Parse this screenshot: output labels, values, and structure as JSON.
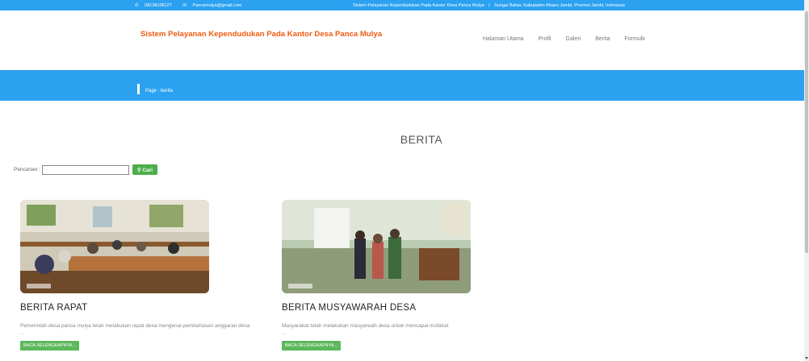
{
  "topbar": {
    "phone": "08138108127",
    "email": "Pancamulya@gmail.com",
    "site_name": "Sistem Pelayanan Kependudukan Pada Kantor Desa Panca Mulya",
    "separator": "|",
    "address": "Sungai Bahar, Kabupaten Muaro Jambi, Provinsi Jambi, Indonesia"
  },
  "navbar": {
    "brand": "Sistem Pelayanan Kependudukan Pada Kantor Desa Panca Mulya",
    "menu": [
      "Halaman Utama",
      "Profil",
      "Galeri",
      "Berita",
      "Formulir"
    ]
  },
  "banner": {
    "page_label": "Page : berita"
  },
  "main": {
    "heading": "BERITA",
    "search": {
      "label": "Pencarian :",
      "value": "",
      "button": "Cari"
    }
  },
  "news": [
    {
      "title": "BERITA RAPAT",
      "description": "Pemerintah desa panca mulya telah melakukan rapat desa mengenai pembahasan anggaran desa",
      "ellipsis": "...",
      "more": "BACA SELENGKAPNYA..."
    },
    {
      "title": "BERITA MUSYAWARAH DESA",
      "description": "Masyarakat telah melakukan masyarwah desa untuk mencapai mufakat",
      "ellipsis": "...",
      "more": "BACA SELENGKAPNYA..."
    }
  ],
  "colors": {
    "primary": "#2ba1f0",
    "brand": "#ef5a12",
    "success": "#5cb85c"
  },
  "icons": {
    "phone": "phone-icon",
    "email": "envelope-icon",
    "search": "search-icon"
  }
}
